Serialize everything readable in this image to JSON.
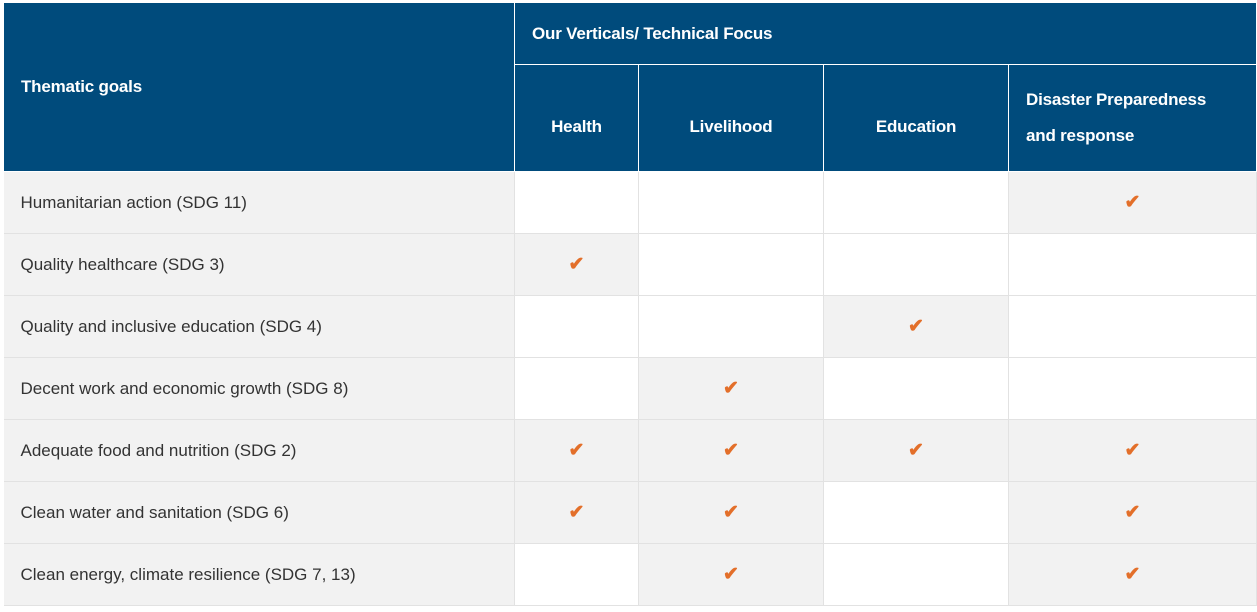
{
  "header": {
    "thematic_goals": "Thematic goals",
    "verticals_group": "Our Verticals/ Technical Focus",
    "columns": [
      "Health",
      "Livelihood",
      "Education"
    ],
    "disaster_line1": "Disaster Preparedness",
    "disaster_line2": "and response"
  },
  "check_symbol": "✔",
  "check_color": "#e36f2a",
  "header_color": "#004b7c",
  "rows": [
    {
      "goal": "Humanitarian action (SDG 11)",
      "checks": [
        false,
        false,
        false,
        true
      ]
    },
    {
      "goal": "Quality healthcare (SDG 3)",
      "checks": [
        true,
        false,
        false,
        false
      ]
    },
    {
      "goal": "Quality and inclusive education (SDG 4)",
      "checks": [
        false,
        false,
        true,
        false
      ]
    },
    {
      "goal": "Decent work and economic growth (SDG 8)",
      "checks": [
        false,
        true,
        false,
        false
      ]
    },
    {
      "goal": "Adequate food and nutrition (SDG 2)",
      "checks": [
        true,
        true,
        true,
        true
      ]
    },
    {
      "goal": "Clean water and sanitation (SDG 6)",
      "checks": [
        true,
        true,
        false,
        true
      ]
    },
    {
      "goal": "Clean energy, climate resilience (SDG 7, 13)",
      "checks": [
        false,
        true,
        false,
        true
      ]
    }
  ]
}
